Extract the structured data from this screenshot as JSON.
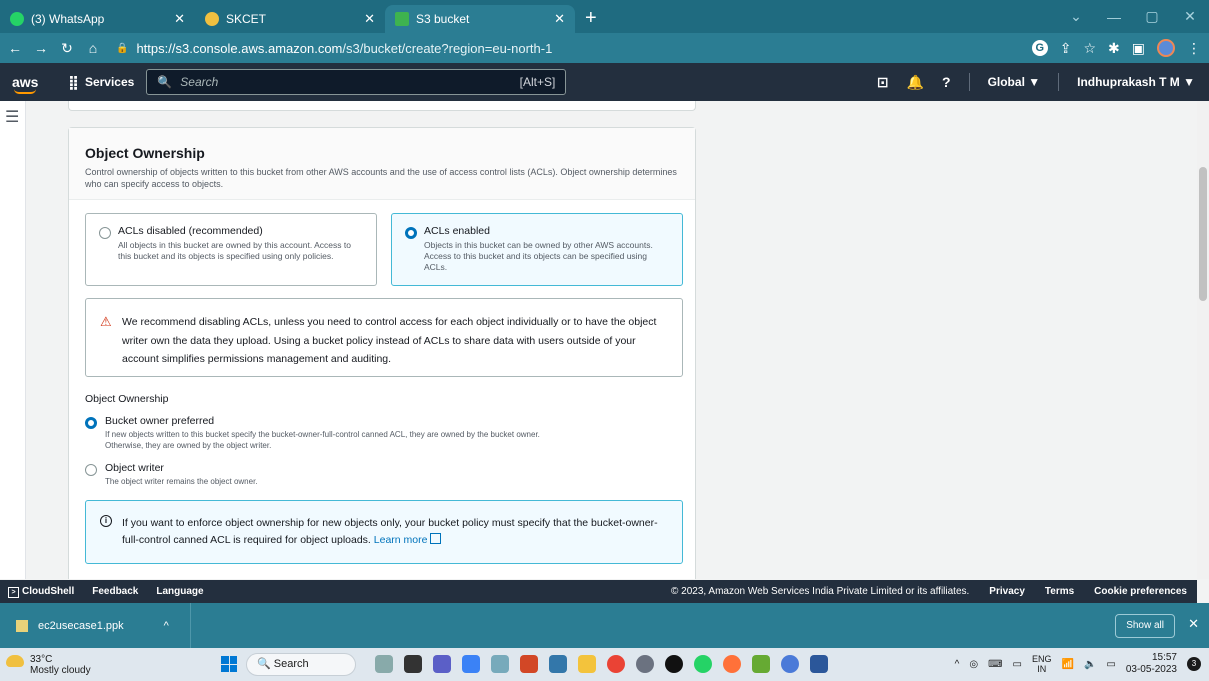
{
  "browser": {
    "tabs": [
      {
        "label": "(3) WhatsApp",
        "icon_color": "#25d366"
      },
      {
        "label": "SKCET",
        "icon_color": "#f0c040"
      },
      {
        "label": "S3 bucket",
        "icon_color": "#3eb34f"
      }
    ],
    "url_host": "https://s3.console.aws.amazon.com",
    "url_path": "/s3/bucket/create?region=eu-north-1"
  },
  "aws_nav": {
    "logo": "aws",
    "services": "Services",
    "search_placeholder": "Search",
    "search_shortcut": "[Alt+S]",
    "region": "Global ▼",
    "user": "Indhuprakash T M ▼"
  },
  "section": {
    "title": "Object Ownership",
    "description": "Control ownership of objects written to this bucket from other AWS accounts and the use of access control lists (ACLs). Object ownership determines who can specify access to objects.",
    "tiles": [
      {
        "label": "ACLs disabled (recommended)",
        "desc": "All objects in this bucket are owned by this account. Access to this bucket and its objects is specified using only policies.",
        "selected": false
      },
      {
        "label": "ACLs enabled",
        "desc": "Objects in this bucket can be owned by other AWS accounts. Access to this bucket and its objects can be specified using ACLs.",
        "selected": true
      }
    ],
    "warning": "We recommend disabling ACLs, unless you need to control access for each object individually or to have the object writer own the data they upload. Using a bucket policy instead of ACLs to share data with users outside of your account simplifies permissions management and auditing.",
    "ownership_label": "Object Ownership",
    "options": [
      {
        "label": "Bucket owner preferred",
        "desc": "If new objects written to this bucket specify the bucket-owner-full-control canned ACL, they are owned by the bucket owner. Otherwise, they are owned by the object writer.",
        "selected": true
      },
      {
        "label": "Object writer",
        "desc": "The object writer remains the object owner.",
        "selected": false
      }
    ],
    "info_text": "If you want to enforce object ownership for new objects only, your bucket policy must specify that the bucket-owner-full-control canned ACL is required for object uploads.",
    "info_link": "Learn more"
  },
  "footer": {
    "cloudshell": "CloudShell",
    "feedback": "Feedback",
    "language": "Language",
    "copyright": "© 2023, Amazon Web Services India Private Limited or its affiliates.",
    "privacy": "Privacy",
    "terms": "Terms",
    "cookies": "Cookie preferences"
  },
  "downloads": {
    "file": "ec2usecase1.ppk",
    "show_all": "Show all"
  },
  "taskbar": {
    "temp": "33°C",
    "weather": "Mostly cloudy",
    "search": "Search",
    "lang1": "ENG",
    "lang2": "IN",
    "time": "15:57",
    "date": "03-05-2023",
    "notifications": "3"
  }
}
